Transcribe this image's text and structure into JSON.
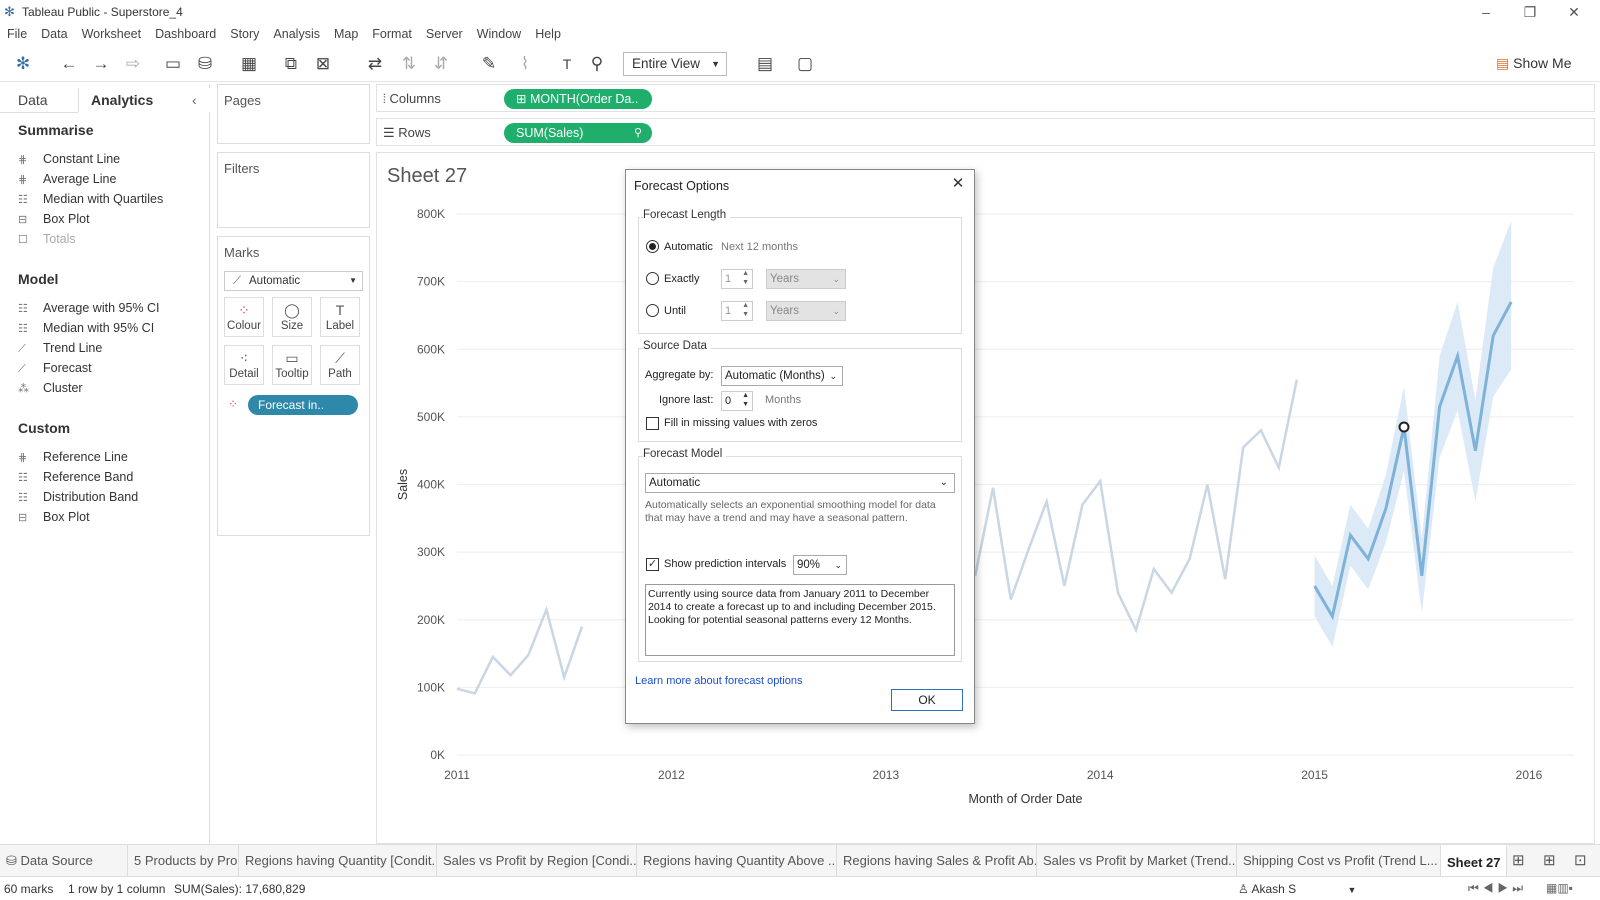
{
  "window": {
    "title": "Tableau Public - Superstore_4"
  },
  "menu": [
    "File",
    "Data",
    "Worksheet",
    "Dashboard",
    "Story",
    "Analysis",
    "Map",
    "Format",
    "Server",
    "Window",
    "Help"
  ],
  "toolbar": {
    "fit_mode": "Entire View",
    "show_me": "Show Me"
  },
  "left_pane": {
    "tab_data": "Data",
    "tab_analytics": "Analytics",
    "sections": [
      {
        "title": "Summarise",
        "items": [
          "Constant Line",
          "Average Line",
          "Median with Quartiles",
          "Box Plot",
          "Totals"
        ]
      },
      {
        "title": "Model",
        "items": [
          "Average with 95% CI",
          "Median with 95% CI",
          "Trend Line",
          "Forecast",
          "Cluster"
        ]
      },
      {
        "title": "Custom",
        "items": [
          "Reference Line",
          "Reference Band",
          "Distribution Band",
          "Box Plot"
        ]
      }
    ]
  },
  "cards": {
    "pages": "Pages",
    "filters": "Filters",
    "marks": "Marks",
    "mark_type": "Automatic",
    "buttons": [
      "Colour",
      "Size",
      "Label",
      "Detail",
      "Tooltip",
      "Path"
    ],
    "forecast_pill": "Forecast in.."
  },
  "shelves": {
    "columns_label": "Columns",
    "columns_pill": "MONTH(Order Da..",
    "rows_label": "Rows",
    "rows_pill": "SUM(Sales)"
  },
  "sheet": {
    "title": "Sheet 27"
  },
  "chart_data": {
    "type": "line",
    "title": "Sheet 27",
    "xlabel": "Month of Order Date",
    "ylabel": "Sales",
    "x_ticks": [
      "2011",
      "2012",
      "2013",
      "2014",
      "2015",
      "2016"
    ],
    "y_ticks": [
      "0K",
      "100K",
      "200K",
      "300K",
      "400K",
      "500K",
      "600K",
      "700K",
      "800K"
    ],
    "ylim": [
      0,
      800000
    ],
    "xlim": [
      2011,
      2016
    ],
    "series": [
      {
        "values_x": [
          2011.0,
          2011.083,
          2011.167,
          2011.25,
          2011.333,
          2011.417,
          2011.5,
          2011.583
        ],
        "values_y": [
          98000,
          91000,
          145000,
          118000,
          148000,
          215000,
          115000,
          190000
        ]
      },
      {
        "values_x": [
          2013.417,
          2013.5,
          2013.583,
          2013.667,
          2013.75,
          2013.833,
          2013.917,
          2014.0,
          2014.083,
          2014.167,
          2014.25,
          2014.333,
          2014.417,
          2014.5,
          2014.583,
          2014.667,
          2014.75,
          2014.833,
          2014.917
        ],
        "values_y": [
          265000,
          395000,
          230000,
          305000,
          375000,
          250000,
          370000,
          405000,
          240000,
          185000,
          275000,
          240000,
          290000,
          400000,
          260000,
          455000,
          480000,
          425000,
          555000
        ]
      }
    ],
    "forecast": {
      "values_x": [
        2015.0,
        2015.083,
        2015.167,
        2015.25,
        2015.333,
        2015.417,
        2015.5,
        2015.583,
        2015.667,
        2015.75,
        2015.833,
        2015.917
      ],
      "values_y": [
        250000,
        205000,
        325000,
        290000,
        365000,
        485000,
        265000,
        515000,
        590000,
        450000,
        620000,
        670000
      ],
      "lower": [
        205000,
        160000,
        280000,
        245000,
        315000,
        420000,
        210000,
        440000,
        510000,
        375000,
        530000,
        570000
      ],
      "upper": [
        295000,
        250000,
        370000,
        335000,
        415000,
        545000,
        320000,
        590000,
        670000,
        525000,
        720000,
        790000
      ],
      "highlight_index": 5
    },
    "colors": {
      "history": "#c9d6e3",
      "forecast": "#7fb2d9",
      "band": "#dce9f6"
    }
  },
  "sheet_tabs": [
    "Data Source",
    "5 Products by Pro...",
    "Regions having Quantity [Condit...",
    "Sales vs Profit by Region [Condi...",
    "Regions having Quantity Above ...",
    "Regions having Sales & Profit Ab...",
    "Sales vs Profit by Market (Trend...",
    "Shipping  Cost vs Profit (Trend L...",
    "Sheet 27"
  ],
  "status": {
    "marks": "60 marks",
    "dims": "1 row by 1 column",
    "sum": "SUM(Sales): 17,680,829",
    "user": "Akash S"
  },
  "dialog": {
    "title": "Forecast Options",
    "forecast_length": "Forecast Length",
    "automatic": "Automatic",
    "automatic_hint": "Next 12 months",
    "exactly": "Exactly",
    "exactly_val": "1",
    "exactly_unit": "Years",
    "until": "Until",
    "until_val": "1",
    "until_unit": "Years",
    "source_data": "Source Data",
    "aggregate_by": "Aggregate by:",
    "aggregate_val": "Automatic (Months)",
    "ignore_last": "Ignore last:",
    "ignore_val": "0",
    "ignore_unit": "Months",
    "fill_missing": "Fill in missing values with zeros",
    "forecast_model": "Forecast Model",
    "model_val": "Automatic",
    "model_desc": "Automatically selects an exponential smoothing model for data that may have a trend and may have a seasonal pattern.",
    "show_pi": "Show prediction intervals",
    "pi_val": "90%",
    "summary": "Currently using source data from January 2011 to December 2014 to create a forecast up to and including December 2015. Looking for potential seasonal patterns every 12 Months.",
    "learn_more": "Learn more about forecast options",
    "ok": "OK"
  }
}
